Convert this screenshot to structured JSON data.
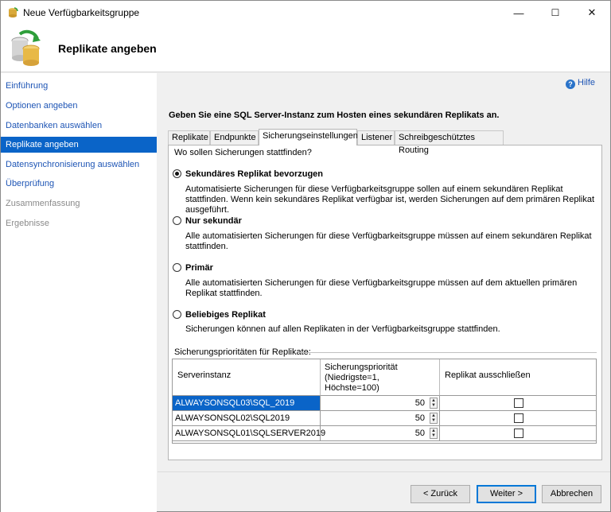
{
  "window": {
    "title": "Neue Verfügbarkeitsgruppe",
    "controls": {
      "minimize": "—",
      "maximize": "☐",
      "close": "✕"
    }
  },
  "header": {
    "title": "Replikate angeben"
  },
  "sidebar": {
    "items": [
      {
        "label": "Einführung",
        "state": "link"
      },
      {
        "label": "Optionen angeben",
        "state": "link"
      },
      {
        "label": "Datenbanken auswählen",
        "state": "link"
      },
      {
        "label": "Replikate angeben",
        "state": "active"
      },
      {
        "label": "Datensynchronisierung auswählen",
        "state": "link"
      },
      {
        "label": "Überprüfung",
        "state": "link"
      },
      {
        "label": "Zusammenfassung",
        "state": "disabled"
      },
      {
        "label": "Ergebnisse",
        "state": "disabled"
      }
    ]
  },
  "help": {
    "label": "Hilfe",
    "icon": "help-icon"
  },
  "instruction": "Geben Sie eine SQL Server-Instanz zum Hosten eines sekundären Replikats an.",
  "tabs": [
    {
      "label": "Replikate"
    },
    {
      "label": "Endpunkte"
    },
    {
      "label": "Sicherungseinstellungen",
      "active": true
    },
    {
      "label": "Listener"
    },
    {
      "label": "Schreibgeschütztes Routing"
    }
  ],
  "backup": {
    "question": "Wo sollen Sicherungen stattfinden?",
    "options": [
      {
        "label": "Sekundäres Replikat bevorzugen",
        "selected": true,
        "desc": "Automatisierte Sicherungen für diese Verfügbarkeitsgruppe sollen auf einem sekundären Replikat stattfinden. Wenn kein sekundäres Replikat verfügbar ist, werden Sicherungen auf dem primären Replikat ausgeführt."
      },
      {
        "label": "Nur sekundär",
        "selected": false,
        "desc": "Alle automatisierten Sicherungen für diese Verfügbarkeitsgruppe müssen auf einem sekundären Replikat stattfinden."
      },
      {
        "label": "Primär",
        "selected": false,
        "desc": "Alle automatisierten Sicherungen für diese Verfügbarkeitsgruppe müssen auf dem aktuellen primären Replikat stattfinden."
      },
      {
        "label": "Beliebiges Replikat",
        "selected": false,
        "desc": "Sicherungen können auf allen Replikaten in der Verfügbarkeitsgruppe stattfinden."
      }
    ],
    "priorities_label": "Sicherungsprioritäten für Replikate:",
    "columns": [
      "Serverinstanz",
      "Sicherungspriorität (Niedrigste=1, Höchste=100)",
      "Replikat ausschließen"
    ],
    "rows": [
      {
        "server": "ALWAYSONSQL03\\SQL_2019",
        "priority": "50",
        "exclude": false,
        "selected": true
      },
      {
        "server": "ALWAYSONSQL02\\SQL2019",
        "priority": "50",
        "exclude": false,
        "selected": false
      },
      {
        "server": "ALWAYSONSQL01\\SQLSERVER2019",
        "priority": "50",
        "exclude": false,
        "selected": false
      }
    ]
  },
  "buttons": {
    "back": "< Zurück",
    "next": "Weiter >",
    "cancel": "Abbrechen"
  },
  "colors": {
    "accent": "#0a64c8",
    "link": "#1e55b5"
  }
}
